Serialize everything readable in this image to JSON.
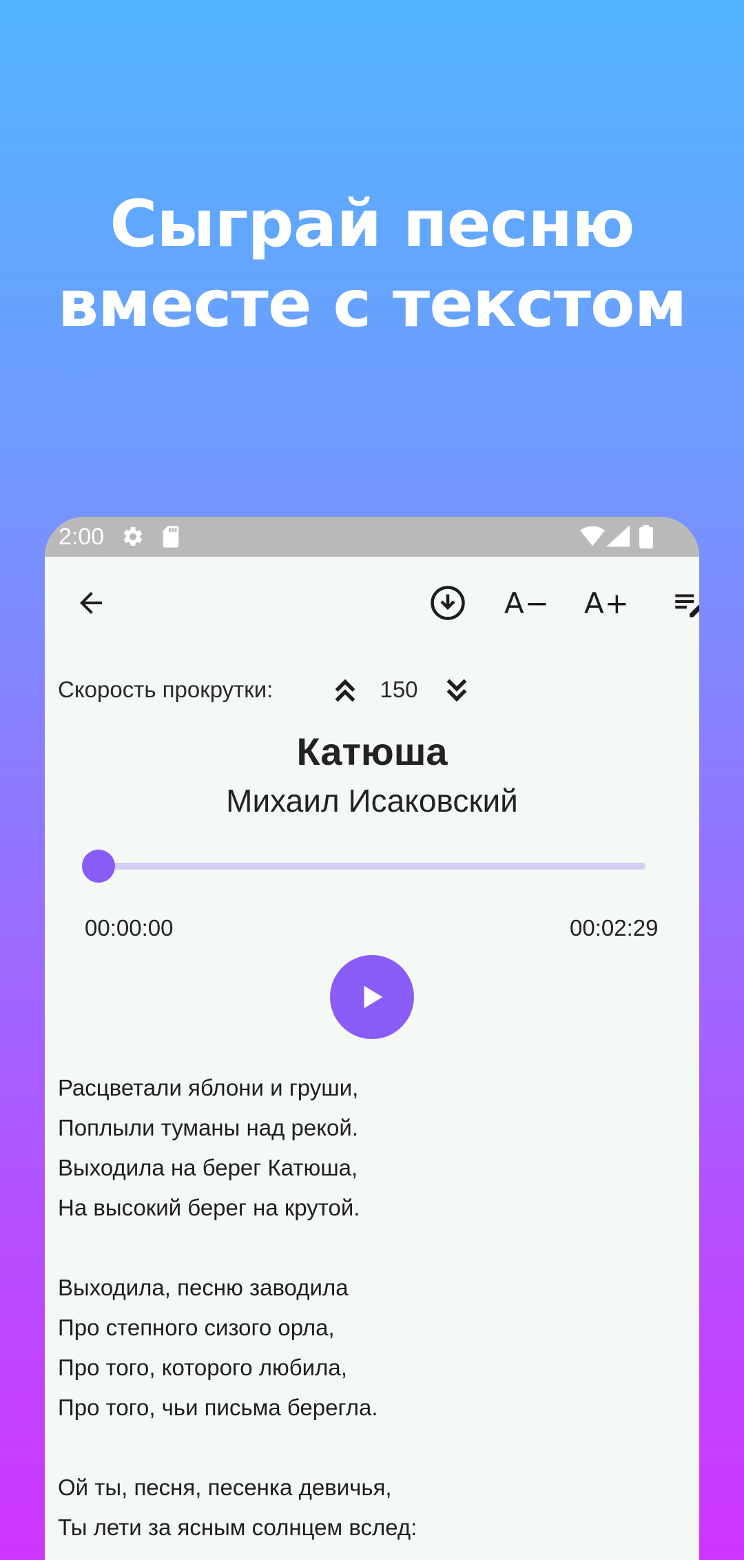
{
  "promo": {
    "line1": "Сыграй песню",
    "line2": "вместе с текстом"
  },
  "status_bar": {
    "time": "2:00",
    "icons": [
      "gear-icon",
      "sd-card-icon",
      "wifi-icon",
      "signal-icon",
      "battery-icon"
    ]
  },
  "toolbar": {
    "back_icon": "arrow-left-icon",
    "download_icon": "download-circle-icon",
    "font_decrease_label": "A−",
    "font_increase_label": "A+",
    "edit_icon": "playlist-edit-icon"
  },
  "scroll_speed": {
    "label": "Скорость прокрутки:",
    "value": "150"
  },
  "song": {
    "title": "Катюша",
    "author": "Михаил Исаковский"
  },
  "player": {
    "current_time": "00:00:00",
    "total_time": "00:02:29",
    "progress": 0
  },
  "lyrics": {
    "lines": [
      "Расцветали яблони и груши,",
      "Поплыли туманы над рекой.",
      "Выходила на берег Катюша,",
      "На высокий берег на крутой.",
      "",
      "Выходила, песню заводила",
      "Про степного сизого орла,",
      "Про того, которого любила,",
      "Про того, чьи письма берегла.",
      "",
      "Ой ты, песня, песенка девичья,",
      "Ты лети за ясным солнцем вслед:"
    ]
  },
  "colors": {
    "accent": "#8a5cf6",
    "track": "#d4cbf7",
    "status_bar": "#b9b9b7",
    "screen_bg": "#f5f9f5"
  }
}
